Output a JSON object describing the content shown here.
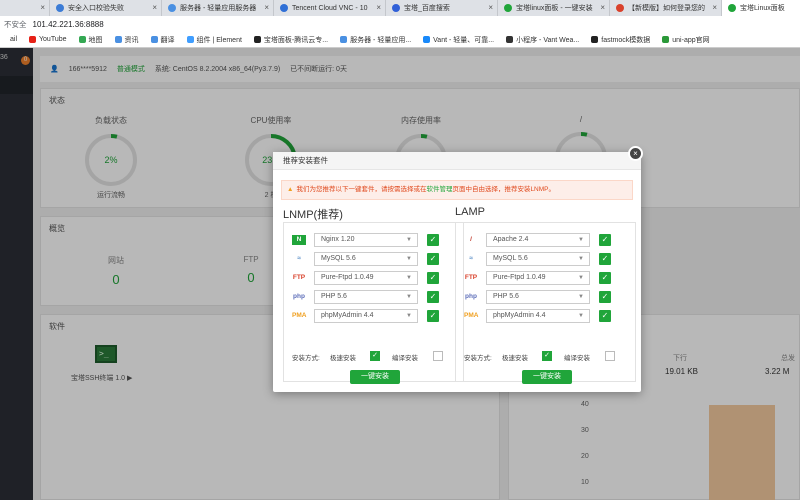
{
  "browser": {
    "tabs": [
      {
        "title": "安全入口校验失败",
        "color": "#3c7cd6",
        "active": false
      },
      {
        "title": "服务器 - 轻量应用服务器",
        "color": "#4a90e2",
        "active": false
      },
      {
        "title": "Tencent Cloud VNC - 10",
        "color": "#2f6fd6",
        "active": false
      },
      {
        "title": "宝塔_百度搜索",
        "color": "#3060d8",
        "active": false
      },
      {
        "title": "宝塔linux面板 - 一键安装",
        "color": "#20a53a",
        "active": false
      },
      {
        "title": "【新模版】如何登录您的",
        "color": "#d9412b",
        "active": false
      },
      {
        "title": "宝塔Linux面板",
        "color": "#20a53a",
        "active": true
      }
    ],
    "first_tab_close": "×",
    "security_warning": "不安全",
    "url": "101.42.221.36:8888",
    "bookmarks": [
      {
        "label": "ail",
        "color": "#ffffff"
      },
      {
        "label": "YouTube",
        "color": "#e62117"
      },
      {
        "label": "地图",
        "color": "#34a853"
      },
      {
        "label": "资讯",
        "color": "#4a90e2"
      },
      {
        "label": "翻译",
        "color": "#4a90e2"
      },
      {
        "label": "组件 | Element",
        "color": "#409eff"
      },
      {
        "label": "宝塔面板-腾讯云专...",
        "color": "#222222"
      },
      {
        "label": "服务器 - 轻量应用...",
        "color": "#4a90e2"
      },
      {
        "label": "Vant - 轻量、可靠...",
        "color": "#1989fa"
      },
      {
        "label": "小程序 - Vant Wea...",
        "color": "#333333"
      },
      {
        "label": "fastmock模数据",
        "color": "#222222"
      },
      {
        "label": "uni-app官网",
        "color": "#2b9939"
      }
    ]
  },
  "sidebar": {
    "server_label": "36",
    "badge": "0"
  },
  "topinfo": {
    "user": "166****5912",
    "edition": "普通模式",
    "system": "系统:  CentOS 8.2.2004 x86_64(Py3.7.9)",
    "uptime": "已不间断运行: 0天"
  },
  "status": {
    "title": "状态",
    "gauges": [
      {
        "label": "负载状态",
        "value": "2%",
        "sub": "运行流畅",
        "percent": 2
      },
      {
        "label": "CPU使用率",
        "value": "23.4",
        "sub": "2 核",
        "percent": 23
      },
      {
        "label": "内存使用率",
        "value": "",
        "sub": "",
        "percent": 0
      },
      {
        "label": "/",
        "value": "",
        "sub": "",
        "percent": 0
      }
    ]
  },
  "overview": {
    "title": "概览",
    "items": [
      {
        "label": "网站",
        "value": "0"
      },
      {
        "label": "FTP",
        "value": "0"
      }
    ]
  },
  "software": {
    "title": "软件",
    "items": [
      {
        "label": "宝塔SSH终端 1.0 ▶",
        "icon_text": ">_"
      }
    ]
  },
  "traffic": {
    "down_label": "下行",
    "down_value": "19.01 KB",
    "total_label": "总发",
    "total_value": "3.22 M",
    "axis_values": [
      "40",
      "30",
      "20",
      "10"
    ]
  },
  "modal": {
    "title": "推荐安装套件",
    "close": "×",
    "alert_icon": "▲",
    "alert_text": "我们为您推荐以下一键套件，请按需选择或在",
    "alert_link": "软件管理",
    "alert_tail": "页面中自由选择，推荐安装LNMP。",
    "columns": [
      {
        "title": "LNMP(推荐)",
        "rows": [
          {
            "icon": "N",
            "icon_color": "#ffffff",
            "icon_bg": "#20a53a",
            "value": "Nginx 1.20",
            "checked": true
          },
          {
            "icon": "≈",
            "icon_color": "#5b8fc7",
            "icon_bg": "#ffffff",
            "value": "MySQL 5.6",
            "checked": true
          },
          {
            "icon": "FTP",
            "icon_color": "#d9412b",
            "icon_bg": "#ffffff",
            "value": "Pure-Ftpd 1.0.49",
            "checked": true
          },
          {
            "icon": "php",
            "icon_color": "#5a6bb8",
            "icon_bg": "#ffffff",
            "value": "PHP 5.6",
            "checked": true
          },
          {
            "icon": "PMA",
            "icon_color": "#f0a020",
            "icon_bg": "#ffffff",
            "value": "phpMyAdmin 4.4",
            "checked": true
          }
        ],
        "method_label": "安装方式:",
        "opt_fast": "极速安装",
        "opt_compile": "编译安装",
        "fast_checked": true,
        "compile_checked": false,
        "button": "一键安装"
      },
      {
        "title": "LAMP",
        "rows": [
          {
            "icon": "/",
            "icon_color": "#c0392b",
            "icon_bg": "#ffffff",
            "value": "Apache 2.4",
            "checked": true
          },
          {
            "icon": "≈",
            "icon_color": "#5b8fc7",
            "icon_bg": "#ffffff",
            "value": "MySQL 5.6",
            "checked": true
          },
          {
            "icon": "FTP",
            "icon_color": "#d9412b",
            "icon_bg": "#ffffff",
            "value": "Pure-Ftpd 1.0.49",
            "checked": true
          },
          {
            "icon": "php",
            "icon_color": "#5a6bb8",
            "icon_bg": "#ffffff",
            "value": "PHP 5.6",
            "checked": true
          },
          {
            "icon": "PMA",
            "icon_color": "#f0a020",
            "icon_bg": "#ffffff",
            "value": "phpMyAdmin 4.4",
            "checked": true
          }
        ],
        "method_label": "安装方式:",
        "opt_fast": "极速安装",
        "opt_compile": "编译安装",
        "fast_checked": true,
        "compile_checked": false,
        "button": "一键安装"
      }
    ]
  },
  "colors": {
    "accent": "#20a53a",
    "warning": "#e04a1e",
    "sidebar": "#2b2f36"
  }
}
